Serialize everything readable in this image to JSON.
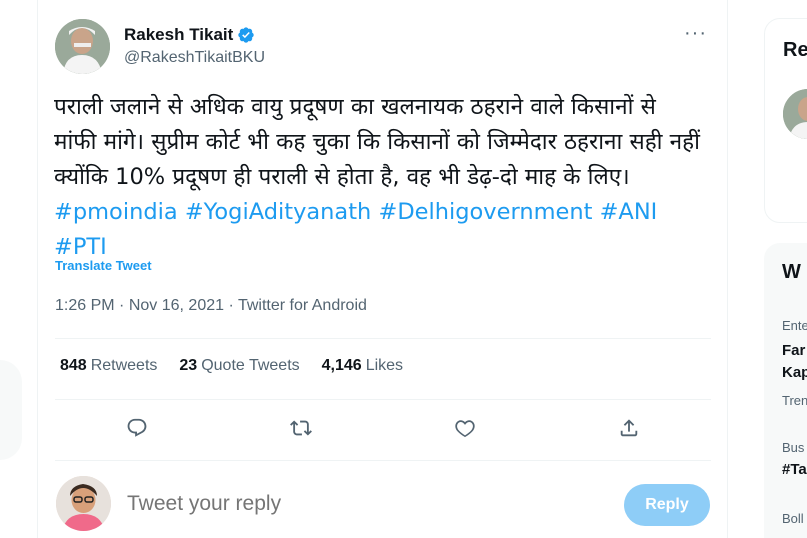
{
  "tweet": {
    "author": {
      "display_name": "Rakesh Tikait",
      "handle": "@RakeshTikaitBKU",
      "verified": true
    },
    "text_plain": "पराली जलाने से अधिक वायु प्रदूषण का खलनायक ठहराने वाले किसानों से मांफी मांगे। सुप्रीम कोर्ट भी कह चुका कि किसानों को जिम्मेदार ठहराना सही नहीं क्योंकि 10% प्रदूषण ही पराली से होता है, वह भी डेढ़-दो माह के लिए।",
    "hashtags": [
      "#pmoindia",
      "#YogiAdityanath",
      "#Delhigovernment",
      "#ANI",
      "#PTI"
    ],
    "translate_label": "Translate Tweet",
    "time": "1:26 PM",
    "date": "Nov 16, 2021",
    "source": "Twitter for Android",
    "meta_separator": "·"
  },
  "stats": {
    "retweets_count": "848",
    "retweets_label": "Retweets",
    "quotes_count": "23",
    "quotes_label": "Quote Tweets",
    "likes_count": "4,146",
    "likes_label": "Likes"
  },
  "reply": {
    "placeholder": "Tweet your reply",
    "button_label": "Reply"
  },
  "sidebar": {
    "relevant_title": "Re",
    "happening_title": "W",
    "trend_items": [
      {
        "category": "Ente",
        "title_line1": "Far",
        "title_line2": "Kap",
        "footer": "Tren"
      },
      {
        "category": "Bus",
        "title_line1": "#Ta"
      },
      {
        "category": "Boll"
      }
    ]
  },
  "colors": {
    "accent": "#1d9bf0",
    "reply_button": "#8ecdf7",
    "secondary_text": "#536471"
  }
}
